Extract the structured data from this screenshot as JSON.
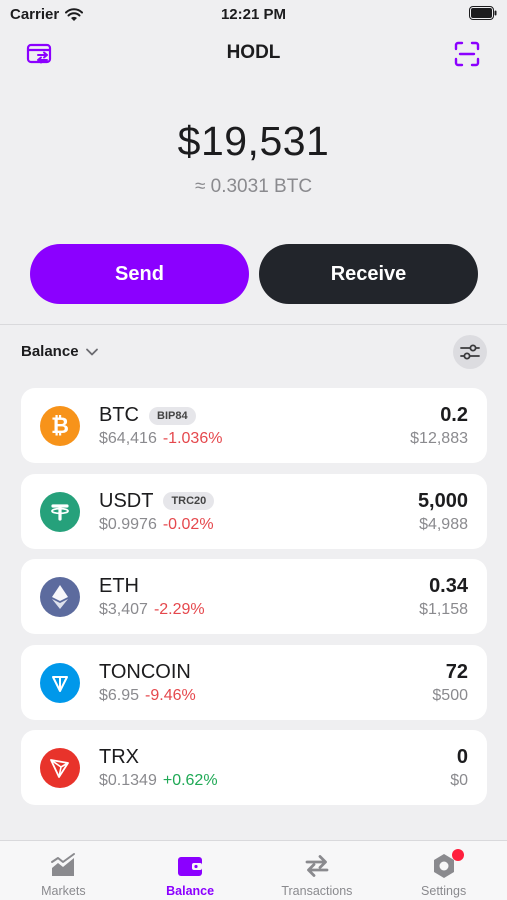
{
  "status_bar": {
    "carrier": "Carrier",
    "time": "12:21 PM"
  },
  "nav": {
    "title": "HODL",
    "left_icon": "wallet-swap-icon",
    "right_icon": "scan-icon"
  },
  "balance": {
    "amount": "$19,531",
    "btc": "≈ 0.3031 BTC"
  },
  "actions": {
    "send_label": "Send",
    "receive_label": "Receive"
  },
  "section": {
    "label": "Balance"
  },
  "colors": {
    "accent": "#8b00ff",
    "dark_button": "#22252b",
    "negative": "#e5484d",
    "positive": "#20a956"
  },
  "assets": [
    {
      "symbol": "BTC",
      "tag": "BIP84",
      "price": "$64,416",
      "change": "-1.036%",
      "amount": "0.2",
      "value": "$12,883"
    },
    {
      "symbol": "USDT",
      "tag": "TRC20",
      "price": "$0.9976",
      "change": "-0.02%",
      "amount": "5,000",
      "value": "$4,988"
    },
    {
      "symbol": "ETH",
      "tag": "",
      "price": "$3,407",
      "change": "-2.29%",
      "amount": "0.34",
      "value": "$1,158"
    },
    {
      "symbol": "TONCOIN",
      "tag": "",
      "price": "$6.95",
      "change": "-9.46%",
      "amount": "72",
      "value": "$500"
    },
    {
      "symbol": "TRX",
      "tag": "",
      "price": "$0.1349",
      "change": "+0.62%",
      "amount": "0",
      "value": "$0"
    }
  ],
  "tabs": [
    {
      "label": "Markets",
      "icon": "chart-icon",
      "active": false
    },
    {
      "label": "Balance",
      "icon": "wallet-icon",
      "active": true
    },
    {
      "label": "Transactions",
      "icon": "swap-arrows-icon",
      "active": false
    },
    {
      "label": "Settings",
      "icon": "gear-icon",
      "active": false,
      "badge": true
    }
  ]
}
